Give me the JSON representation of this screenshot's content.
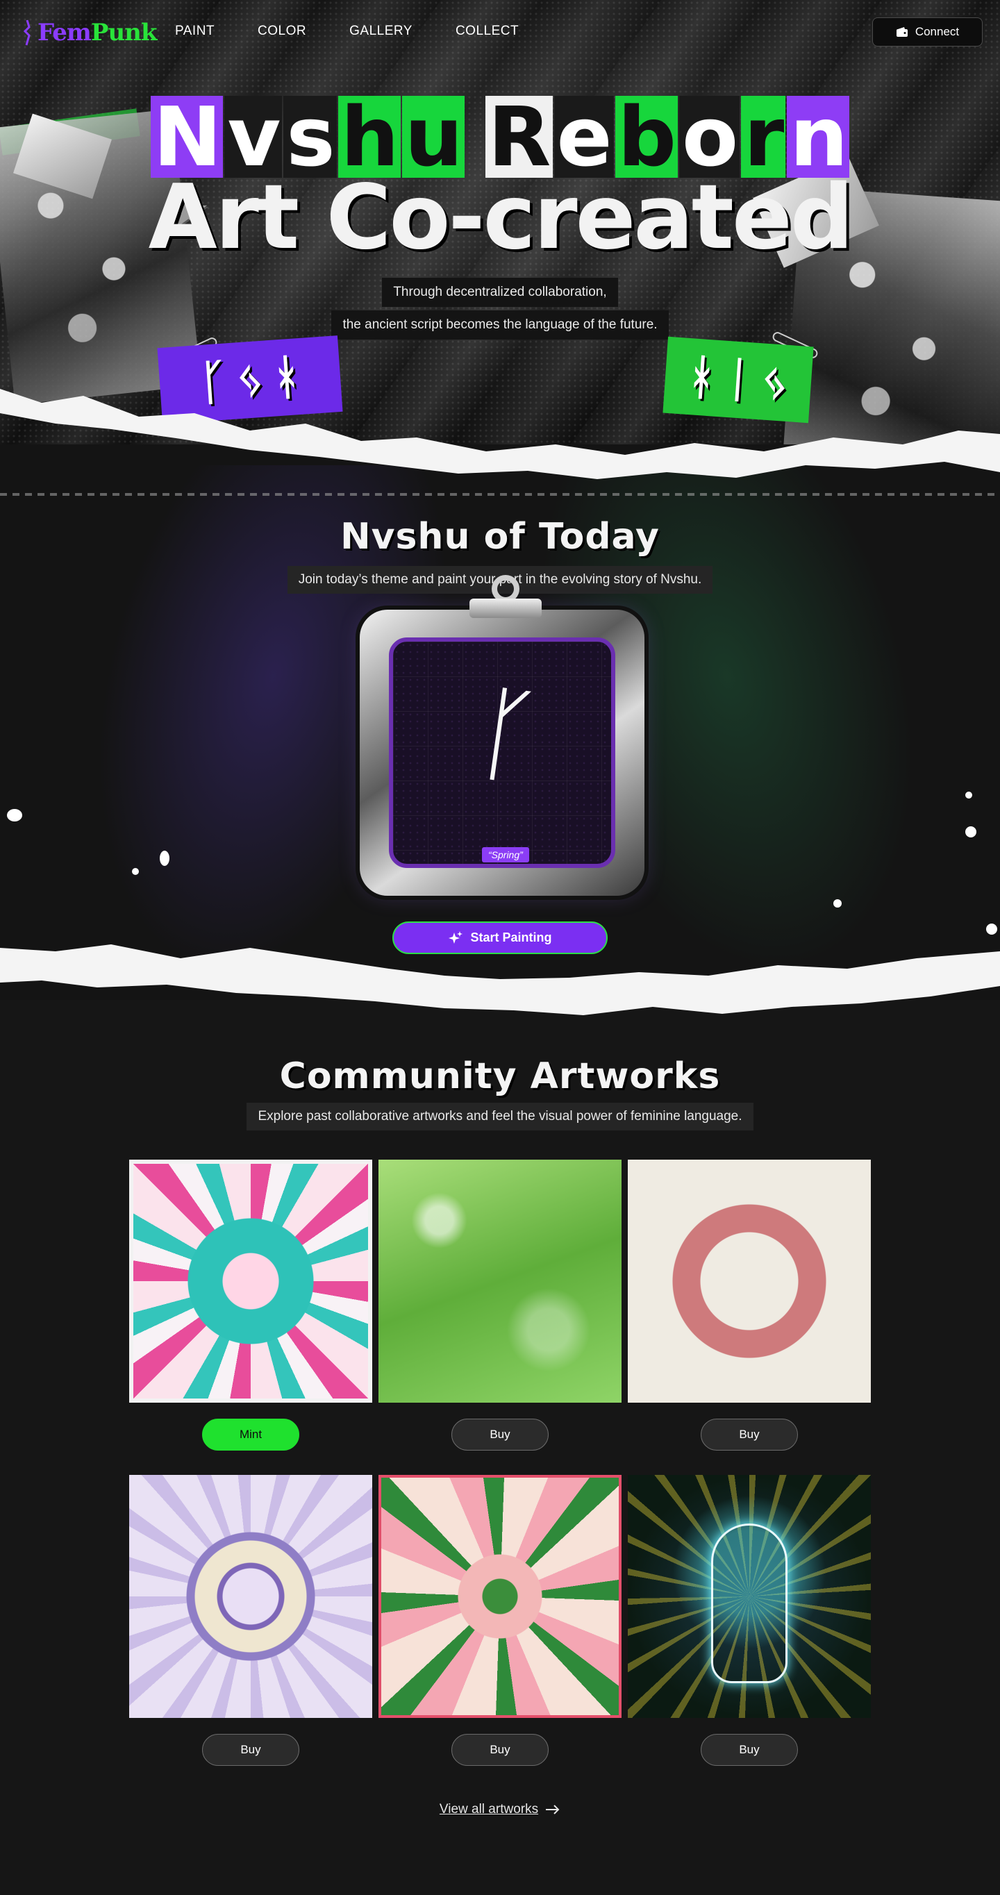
{
  "nav": {
    "logo": {
      "fem": "Fem",
      "punk": "Punk"
    },
    "links": [
      "PAINT",
      "COLOR",
      "GALLERY",
      "COLLECT"
    ],
    "connect_label": "Connect"
  },
  "hero": {
    "title_line1": [
      "N",
      "v",
      "s",
      "h",
      "u",
      " ",
      "R",
      "e",
      "b",
      "o",
      "r",
      "n"
    ],
    "title_line2": "Art Co-created",
    "subtitle_line1": "Through decentralized collaboration,",
    "subtitle_line2": "the ancient script becomes the language of the future."
  },
  "today": {
    "title": "Nvshu of Today",
    "subtitle": "Join today’s theme and paint your part in the evolving story of Nvshu.",
    "theme_tag": "“Spring”",
    "start_label": "Start Painting"
  },
  "community": {
    "title": "Community Artworks",
    "subtitle": "Explore past collaborative artworks and feel the visual power of feminine language.",
    "artworks": [
      {
        "button": "Mint"
      },
      {
        "button": "Buy"
      },
      {
        "button": "Buy"
      },
      {
        "button": "Buy"
      },
      {
        "button": "Buy"
      },
      {
        "button": "Buy"
      }
    ],
    "view_all_label": "View all artworks"
  },
  "colors": {
    "purple": "#7b2ff2",
    "green": "#1fe12e",
    "background": "#161616"
  }
}
